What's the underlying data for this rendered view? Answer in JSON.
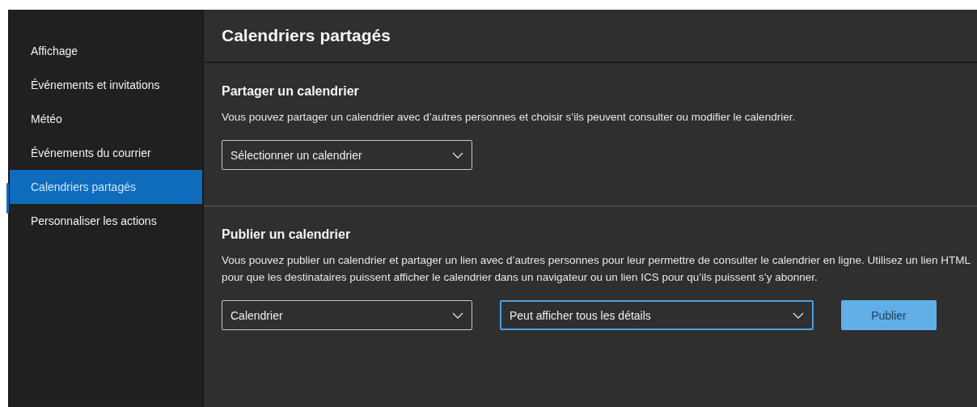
{
  "sidebar": {
    "items": [
      {
        "label": "Affichage",
        "selected": false
      },
      {
        "label": "Événements et invitations",
        "selected": false
      },
      {
        "label": "Météo",
        "selected": false
      },
      {
        "label": "Événements du courrier",
        "selected": false
      },
      {
        "label": "Calendriers partagés",
        "selected": true
      },
      {
        "label": "Personnaliser les actions",
        "selected": false
      }
    ]
  },
  "page_title": "Calendriers partagés",
  "sections": [
    {
      "heading": "Partager un calendrier",
      "description": "Vous pouvez partager un calendrier avec d’autres personnes et choisir s’ils peuvent consulter ou modifier le calendrier.",
      "controls": [
        {
          "kind": "dropdown",
          "value": "Sélectionner un calendrier",
          "focused": false
        }
      ]
    },
    {
      "heading": "Publier un calendrier",
      "description": "Vous pouvez publier un calendrier et partager un lien avec d’autres personnes pour leur permettre de consulter le calendrier en ligne. Utilisez un lien HTML pour que les destinataires puissent afficher le calendrier dans un navigateur ou un lien ICS pour qu’ils puissent s’y abonner.",
      "controls": [
        {
          "kind": "dropdown",
          "value": "Calendrier",
          "focused": false
        },
        {
          "kind": "dropdown",
          "value": "Peut afficher tous les détails",
          "focused": true,
          "wide": true
        },
        {
          "kind": "button",
          "label": "Publier"
        }
      ]
    }
  ]
}
